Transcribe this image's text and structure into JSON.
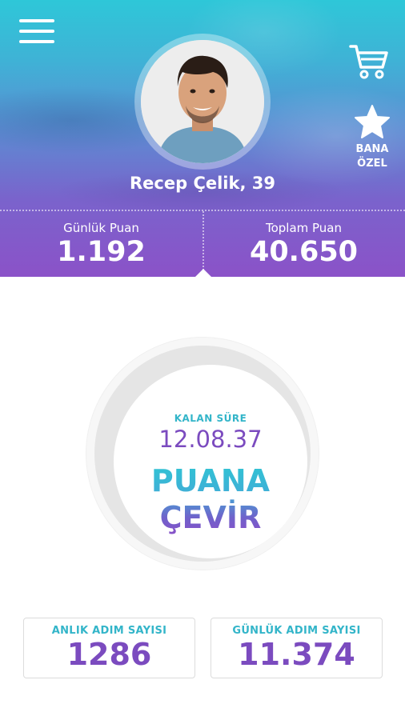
{
  "header": {
    "user_name": "Recep Çelik, 39",
    "bana_ozel_label": "BANA\nÖZEL"
  },
  "stats": {
    "daily_points_label": "Günlük Puan",
    "daily_points_value": "1.192",
    "total_points_label": "Toplam Puan",
    "total_points_value": "40.650"
  },
  "dial": {
    "remaining_label": "KALAN SÜRE",
    "remaining_time": "12.08.37",
    "convert_label": "PUANA\nÇEVİR"
  },
  "cards": {
    "instant_steps_label": "ANLIK ADIM SAYISI",
    "instant_steps_value": "1286",
    "daily_steps_label": "GÜNLÜK ADIM SAYISI",
    "daily_steps_value": "11.374"
  },
  "icons": {
    "menu": "hamburger-menu-icon",
    "cart": "shopping-cart-icon",
    "star": "star-icon"
  },
  "colors": {
    "accent_cyan": "#33b5c9",
    "accent_purple": "#7b4bbf",
    "header_top": "#2ec7d8",
    "header_bottom": "#8b52c8"
  }
}
